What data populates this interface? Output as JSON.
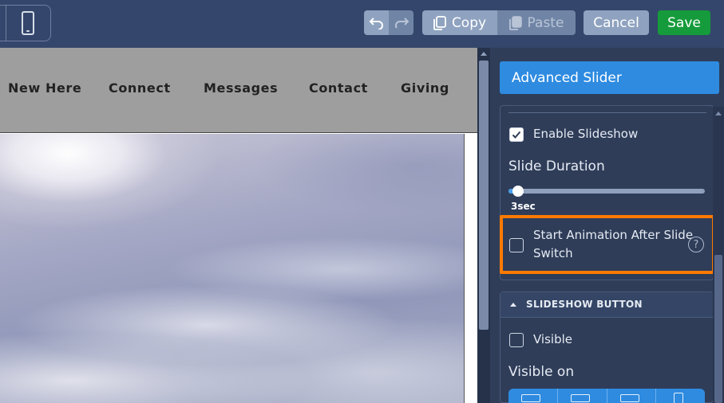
{
  "toolbar": {
    "copy_label": "Copy",
    "paste_label": "Paste",
    "cancel_label": "Cancel",
    "save_label": "Save",
    "icons": [
      "phone-icon",
      "undo-icon",
      "redo-icon",
      "copy-icon",
      "paste-icon"
    ]
  },
  "site_nav": {
    "items": [
      "New Here",
      "Connect",
      "Messages",
      "Contact",
      "Giving"
    ]
  },
  "panel": {
    "title": "Advanced Slider",
    "enable_slideshow": {
      "label": "Enable Slideshow",
      "checked": true
    },
    "slide_duration": {
      "label": "Slide Duration",
      "value_label": "3sec",
      "fraction": 0.05
    },
    "start_animation": {
      "label_line1": "Start Animation After Slide",
      "label_line2": "Switch",
      "checked": false
    },
    "slideshow_button": {
      "title": "SLIDESHOW BUTTON",
      "visible": {
        "label": "Visible",
        "checked": false
      },
      "visible_on_label": "Visible on"
    }
  },
  "colors": {
    "accent": "#2e8be0",
    "save": "#159b3b",
    "highlight": "#ff7a00"
  }
}
